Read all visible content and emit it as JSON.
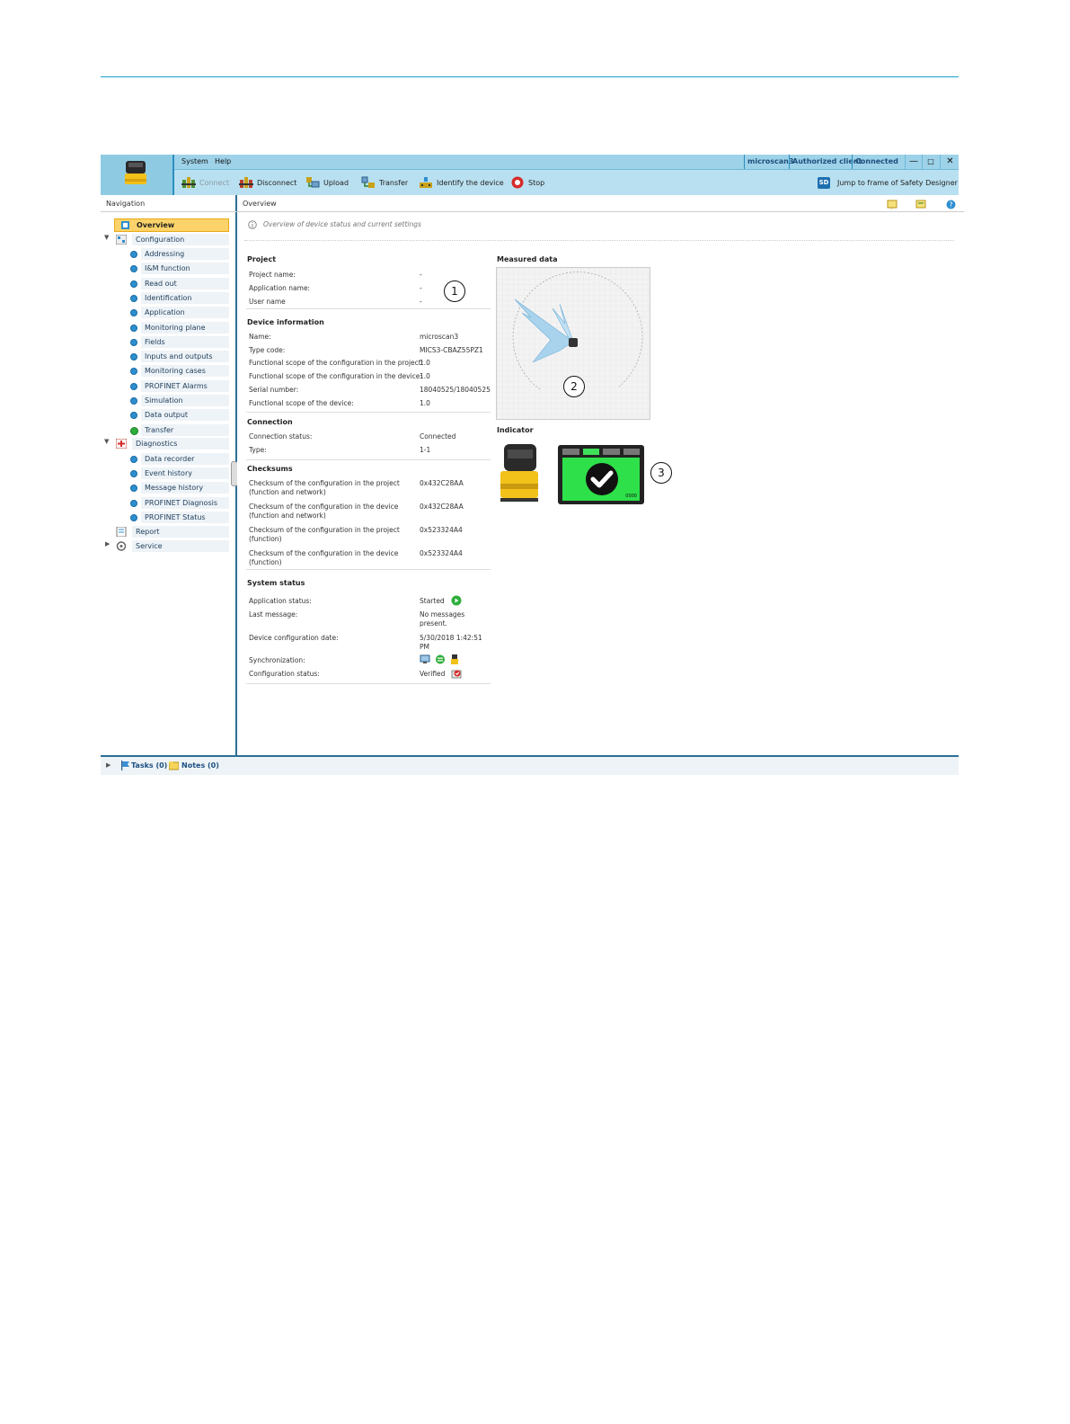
{
  "menu": {
    "system": "System",
    "help": "Help"
  },
  "status": {
    "device": "microscan3",
    "client": "Authorized client",
    "connection": "Connected"
  },
  "window": {
    "minimize": "—",
    "maximize": "□",
    "close": "✕"
  },
  "toolbar": {
    "connect": "Connect",
    "disconnect": "Disconnect",
    "upload": "Upload",
    "transfer": "Transfer",
    "identify": "Identify the device",
    "stop": "Stop",
    "jump_badge": "SD",
    "jump": "Jump to frame of Safety Designer"
  },
  "navigation": {
    "header": "Navigation",
    "overview": "Overview",
    "configuration": "Configuration",
    "config_items": [
      "Addressing",
      "I&M function",
      "Read out",
      "Identification",
      "Application",
      "Monitoring plane",
      "Fields",
      "Inputs and outputs",
      "Monitoring cases",
      "PROFINET Alarms",
      "Simulation",
      "Data output",
      "Transfer"
    ],
    "diagnostics": "Diagnostics",
    "diag_items": [
      "Data recorder",
      "Event history",
      "Message history",
      "PROFINET Diagnosis",
      "PROFINET Status"
    ],
    "report": "Report",
    "service": "Service"
  },
  "content": {
    "header": "Overview",
    "subtitle": "Overview of device status and current settings",
    "project": {
      "title": "Project",
      "rows": [
        {
          "label": "Project name:",
          "value": "-"
        },
        {
          "label": "Application name:",
          "value": "-"
        },
        {
          "label": "User name",
          "value": "-"
        }
      ]
    },
    "device_info": {
      "title": "Device information",
      "rows": [
        {
          "label": "Name:",
          "value": "microscan3"
        },
        {
          "label": "Type code:",
          "value": "MICS3-CBAZ55PZ1"
        },
        {
          "label": "Functional scope of the configuration in the project:",
          "value": "1.0"
        },
        {
          "label": "Functional scope of the configuration in the device:",
          "value": "1.0"
        },
        {
          "label": "Serial number:",
          "value": "18040525/18040525"
        },
        {
          "label": "Functional scope of the device:",
          "value": "1.0"
        }
      ]
    },
    "connection": {
      "title": "Connection",
      "rows": [
        {
          "label": "Connection status:",
          "value": "Connected"
        },
        {
          "label": "Type:",
          "value": "1-1"
        }
      ]
    },
    "checksums": {
      "title": "Checksums",
      "rows": [
        {
          "label1": "Checksum of the configuration in the project",
          "label2": "(function and network)",
          "value": "0x432C28AA"
        },
        {
          "label1": "Checksum of the configuration in the device",
          "label2": "(function and network)",
          "value": "0x432C28AA"
        },
        {
          "label1": "Checksum of the configuration in the project",
          "label2": "(function)",
          "value": "0x523324A4"
        },
        {
          "label1": "Checksum of the configuration in the device",
          "label2": "(function)",
          "value": "0x523324A4"
        }
      ]
    },
    "system_status": {
      "title": "System status",
      "app_status_label": "Application status:",
      "app_status_value": "Started",
      "last_message_label": "Last message:",
      "last_message_value1": "No messages",
      "last_message_value2": "present.",
      "config_date_label": "Device configuration date:",
      "config_date_value1": "5/30/2018 1:42:51",
      "config_date_value2": "PM",
      "sync_label": "Synchronization:",
      "config_status_label": "Configuration status:",
      "config_status_value": "Verified"
    },
    "measured_data_title": "Measured data",
    "indicator_title": "Indicator",
    "indicator_code": "0000",
    "callouts": [
      "1",
      "2",
      "3"
    ]
  },
  "bottom": {
    "tasks": "Tasks (0)",
    "notes": "Notes (0)"
  },
  "colors": {
    "accent": "#2b8fc0",
    "selected": "#fbd36a",
    "indicator_green": "#2ee04a",
    "device_yellow": "#f2c11a"
  }
}
